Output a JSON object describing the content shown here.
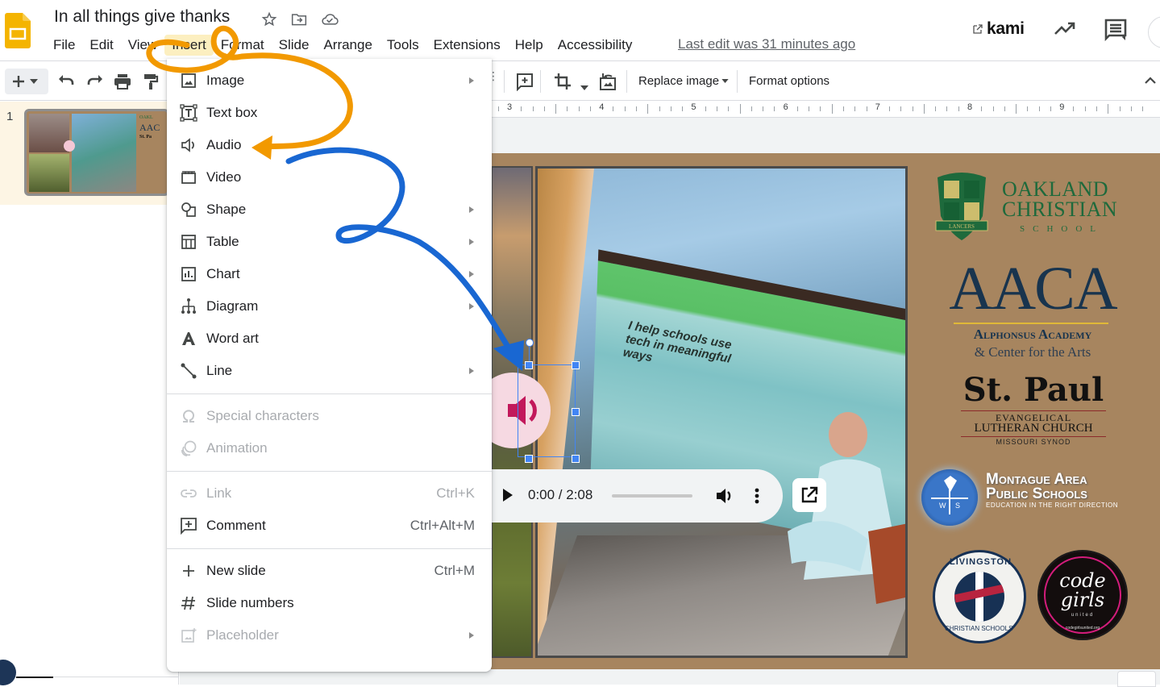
{
  "header": {
    "title": "In all things give thanks",
    "title_icons": [
      "star-icon",
      "move-to-folder-icon",
      "cloud-saved-icon"
    ],
    "menu": [
      {
        "label": "File",
        "active": false
      },
      {
        "label": "Edit",
        "active": false
      },
      {
        "label": "View",
        "active": false
      },
      {
        "label": "Insert",
        "active": true
      },
      {
        "label": "Format",
        "active": false
      },
      {
        "label": "Slide",
        "active": false
      },
      {
        "label": "Arrange",
        "active": false
      },
      {
        "label": "Tools",
        "active": false
      },
      {
        "label": "Extensions",
        "active": false
      },
      {
        "label": "Help",
        "active": false
      },
      {
        "label": "Accessibility",
        "active": false
      }
    ],
    "last_edit": "Last edit was 31 minutes ago",
    "kami_label": "kami",
    "right_icons": [
      "activity-trend-icon",
      "comments-icon"
    ]
  },
  "toolbar": {
    "left_icons": [
      "new-slide-plus-icon",
      "undo-icon",
      "redo-icon",
      "print-icon",
      "paint-format-icon"
    ],
    "image_icons": [
      "add-comment-icon",
      "crop-icon",
      "reset-image-icon"
    ],
    "replace_image_label": "Replace image",
    "format_options_label": "Format options"
  },
  "ruler": {
    "numbers": [
      "3",
      "4",
      "5",
      "6",
      "7",
      "8",
      "9"
    ]
  },
  "filmstrip": {
    "slides": [
      {
        "number": "1",
        "selected": true
      }
    ]
  },
  "insert_menu": {
    "groups": [
      [
        {
          "label": "Image",
          "icon": "image-icon",
          "submenu": true,
          "disabled": false
        },
        {
          "label": "Text box",
          "icon": "text-box-icon",
          "submenu": false,
          "disabled": false
        },
        {
          "label": "Audio",
          "icon": "audio-icon",
          "submenu": false,
          "disabled": false
        },
        {
          "label": "Video",
          "icon": "video-icon",
          "submenu": false,
          "disabled": false
        },
        {
          "label": "Shape",
          "icon": "shape-icon",
          "submenu": true,
          "disabled": false
        },
        {
          "label": "Table",
          "icon": "table-icon",
          "submenu": true,
          "disabled": false
        },
        {
          "label": "Chart",
          "icon": "chart-icon",
          "submenu": true,
          "disabled": false
        },
        {
          "label": "Diagram",
          "icon": "diagram-icon",
          "submenu": true,
          "disabled": false
        },
        {
          "label": "Word art",
          "icon": "word-art-icon",
          "submenu": false,
          "disabled": false
        },
        {
          "label": "Line",
          "icon": "line-icon",
          "submenu": true,
          "disabled": false
        }
      ],
      [
        {
          "label": "Special characters",
          "icon": "omega-icon",
          "submenu": false,
          "disabled": true
        },
        {
          "label": "Animation",
          "icon": "animation-icon",
          "submenu": false,
          "disabled": true
        }
      ],
      [
        {
          "label": "Link",
          "icon": "link-icon",
          "shortcut": "Ctrl+K",
          "submenu": false,
          "disabled": true
        },
        {
          "label": "Comment",
          "icon": "comment-add-icon",
          "shortcut": "Ctrl+Alt+M",
          "submenu": false,
          "disabled": false
        }
      ],
      [
        {
          "label": "New slide",
          "icon": "plus-icon",
          "shortcut": "Ctrl+M",
          "submenu": false,
          "disabled": false
        },
        {
          "label": "Slide numbers",
          "icon": "hash-icon",
          "submenu": false,
          "disabled": false
        },
        {
          "label": "Placeholder",
          "icon": "placeholder-icon",
          "submenu": true,
          "disabled": true
        }
      ]
    ]
  },
  "slide": {
    "background_color": "#a7855f",
    "laptop_screen_text": "I help schools use tech in meaningful ways",
    "logos": {
      "oakland": {
        "name_line1": "OAKLAND",
        "name_line2": "CHRISTIAN",
        "sub": "SCHOOL",
        "banner": "LANCERS"
      },
      "aaca": {
        "big": "AACA",
        "sub1": "Alphonsus Academy",
        "sub2": "& Center for the Arts"
      },
      "stpaul": {
        "big": "St. Paul",
        "sub1": "EVANGELICAL",
        "sub2": "LUTHERAN CHURCH",
        "sub3": "MISSOURI SYNOD"
      },
      "montague": {
        "line1": "Montague Area",
        "line2": "Public Schools",
        "line3": "EDUCATION IN THE RIGHT DIRECTION"
      },
      "livingston": {
        "top": "LIVINGSTON",
        "bottom": "CHRISTIAN SCHOOLS"
      },
      "codegirls": {
        "main": "code girls",
        "sub": "united",
        "url": "codegirlsunited.org"
      }
    },
    "audio_player": {
      "time": "0:00 / 2:08",
      "progress": 0
    }
  },
  "colors": {
    "accent_insert_highlight": "#fcefc0",
    "selection_blue": "#4285f4",
    "annotation_orange": "#f29900",
    "annotation_blue": "#1967d2",
    "audio_icon_pink": "#c2185b"
  }
}
